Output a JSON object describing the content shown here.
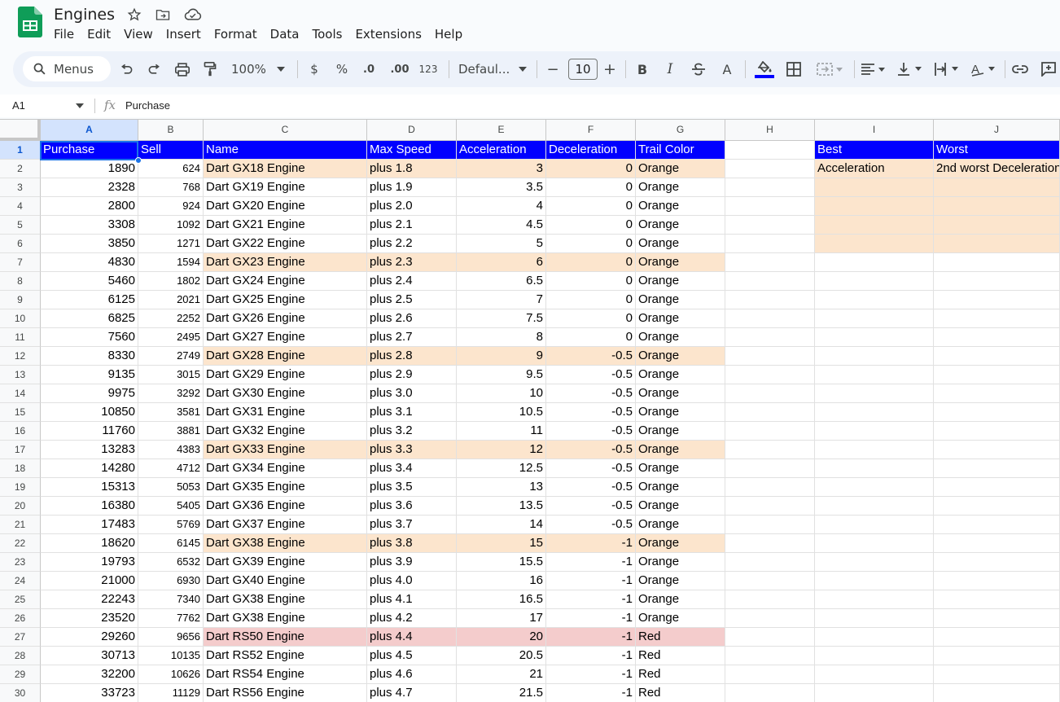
{
  "app": {
    "title": "Engines",
    "brand_color": "#0f9d58"
  },
  "menu": [
    "File",
    "Edit",
    "View",
    "Insert",
    "Format",
    "Data",
    "Tools",
    "Extensions",
    "Help"
  ],
  "toolbar": {
    "search_label": "Menus",
    "zoom": "100%",
    "currency": "$",
    "percent": "%",
    "dec_decrease": ".0",
    "dec_increase": ".00",
    "number_format": "123",
    "font": "Defaul...",
    "font_size": "10",
    "minus": "−",
    "plus": "+"
  },
  "formula_bar": {
    "cell_ref": "A1",
    "fx": "fx",
    "value": "Purchase"
  },
  "columns": [
    "A",
    "B",
    "C",
    "D",
    "E",
    "F",
    "G",
    "H",
    "I",
    "J"
  ],
  "headers": [
    "Purchase",
    "Sell",
    "Name",
    "Max Speed",
    "Acceleration",
    "Deceleration",
    "Trail Color"
  ],
  "side_table": {
    "headers": [
      "Best",
      "Worst"
    ],
    "row1": [
      "Acceleration",
      "2nd worst Deceleration"
    ]
  },
  "rows": [
    {
      "n": "2",
      "purchase": "1890",
      "sell": "624",
      "name": "Dart GX18 Engine",
      "speed": "plus 1.8",
      "acc": "3",
      "dec": "0",
      "trail": "Orange",
      "hl": "orange"
    },
    {
      "n": "3",
      "purchase": "2328",
      "sell": "768",
      "name": "Dart GX19 Engine",
      "speed": "plus 1.9",
      "acc": "3.5",
      "dec": "0",
      "trail": "Orange",
      "hl": ""
    },
    {
      "n": "4",
      "purchase": "2800",
      "sell": "924",
      "name": "Dart GX20 Engine",
      "speed": "plus 2.0",
      "acc": "4",
      "dec": "0",
      "trail": "Orange",
      "hl": ""
    },
    {
      "n": "5",
      "purchase": "3308",
      "sell": "1092",
      "name": "Dart GX21 Engine",
      "speed": "plus 2.1",
      "acc": "4.5",
      "dec": "0",
      "trail": "Orange",
      "hl": ""
    },
    {
      "n": "6",
      "purchase": "3850",
      "sell": "1271",
      "name": "Dart GX22 Engine",
      "speed": "plus 2.2",
      "acc": "5",
      "dec": "0",
      "trail": "Orange",
      "hl": ""
    },
    {
      "n": "7",
      "purchase": "4830",
      "sell": "1594",
      "name": "Dart GX23 Engine",
      "speed": "plus 2.3",
      "acc": "6",
      "dec": "0",
      "trail": "Orange",
      "hl": "orange"
    },
    {
      "n": "8",
      "purchase": "5460",
      "sell": "1802",
      "name": "Dart GX24 Engine",
      "speed": "plus 2.4",
      "acc": "6.5",
      "dec": "0",
      "trail": "Orange",
      "hl": ""
    },
    {
      "n": "9",
      "purchase": "6125",
      "sell": "2021",
      "name": "Dart GX25 Engine",
      "speed": "plus 2.5",
      "acc": "7",
      "dec": "0",
      "trail": "Orange",
      "hl": ""
    },
    {
      "n": "10",
      "purchase": "6825",
      "sell": "2252",
      "name": "Dart GX26 Engine",
      "speed": "plus 2.6",
      "acc": "7.5",
      "dec": "0",
      "trail": "Orange",
      "hl": ""
    },
    {
      "n": "11",
      "purchase": "7560",
      "sell": "2495",
      "name": "Dart GX27 Engine",
      "speed": "plus 2.7",
      "acc": "8",
      "dec": "0",
      "trail": "Orange",
      "hl": ""
    },
    {
      "n": "12",
      "purchase": "8330",
      "sell": "2749",
      "name": "Dart GX28 Engine",
      "speed": "plus 2.8",
      "acc": "9",
      "dec": "-0.5",
      "trail": "Orange",
      "hl": "orange"
    },
    {
      "n": "13",
      "purchase": "9135",
      "sell": "3015",
      "name": "Dart GX29 Engine",
      "speed": "plus 2.9",
      "acc": "9.5",
      "dec": "-0.5",
      "trail": "Orange",
      "hl": ""
    },
    {
      "n": "14",
      "purchase": "9975",
      "sell": "3292",
      "name": "Dart GX30 Engine",
      "speed": "plus 3.0",
      "acc": "10",
      "dec": "-0.5",
      "trail": "Orange",
      "hl": ""
    },
    {
      "n": "15",
      "purchase": "10850",
      "sell": "3581",
      "name": "Dart GX31 Engine",
      "speed": "plus 3.1",
      "acc": "10.5",
      "dec": "-0.5",
      "trail": "Orange",
      "hl": ""
    },
    {
      "n": "16",
      "purchase": "11760",
      "sell": "3881",
      "name": "Dart GX32 Engine",
      "speed": "plus 3.2",
      "acc": "11",
      "dec": "-0.5",
      "trail": "Orange",
      "hl": ""
    },
    {
      "n": "17",
      "purchase": "13283",
      "sell": "4383",
      "name": "Dart GX33 Engine",
      "speed": "plus 3.3",
      "acc": "12",
      "dec": "-0.5",
      "trail": "Orange",
      "hl": "orange"
    },
    {
      "n": "18",
      "purchase": "14280",
      "sell": "4712",
      "name": "Dart GX34 Engine",
      "speed": "plus 3.4",
      "acc": "12.5",
      "dec": "-0.5",
      "trail": "Orange",
      "hl": ""
    },
    {
      "n": "19",
      "purchase": "15313",
      "sell": "5053",
      "name": "Dart GX35 Engine",
      "speed": "plus 3.5",
      "acc": "13",
      "dec": "-0.5",
      "trail": "Orange",
      "hl": ""
    },
    {
      "n": "20",
      "purchase": "16380",
      "sell": "5405",
      "name": "Dart GX36 Engine",
      "speed": "plus 3.6",
      "acc": "13.5",
      "dec": "-0.5",
      "trail": "Orange",
      "hl": ""
    },
    {
      "n": "21",
      "purchase": "17483",
      "sell": "5769",
      "name": "Dart GX37 Engine",
      "speed": "plus 3.7",
      "acc": "14",
      "dec": "-0.5",
      "trail": "Orange",
      "hl": ""
    },
    {
      "n": "22",
      "purchase": "18620",
      "sell": "6145",
      "name": "Dart GX38 Engine",
      "speed": "plus 3.8",
      "acc": "15",
      "dec": "-1",
      "trail": "Orange",
      "hl": "orange"
    },
    {
      "n": "23",
      "purchase": "19793",
      "sell": "6532",
      "name": "Dart GX39 Engine",
      "speed": "plus 3.9",
      "acc": "15.5",
      "dec": "-1",
      "trail": "Orange",
      "hl": ""
    },
    {
      "n": "24",
      "purchase": "21000",
      "sell": "6930",
      "name": "Dart GX40 Engine",
      "speed": "plus 4.0",
      "acc": "16",
      "dec": "-1",
      "trail": "Orange",
      "hl": ""
    },
    {
      "n": "25",
      "purchase": "22243",
      "sell": "7340",
      "name": "Dart GX38 Engine",
      "speed": "plus 4.1",
      "acc": "16.5",
      "dec": "-1",
      "trail": "Orange",
      "hl": ""
    },
    {
      "n": "26",
      "purchase": "23520",
      "sell": "7762",
      "name": "Dart GX38 Engine",
      "speed": "plus 4.2",
      "acc": "17",
      "dec": "-1",
      "trail": "Orange",
      "hl": ""
    },
    {
      "n": "27",
      "purchase": "29260",
      "sell": "9656",
      "name": "Dart RS50 Engine",
      "speed": "plus 4.4",
      "acc": "20",
      "dec": "-1",
      "trail": "Red",
      "hl": "red"
    },
    {
      "n": "28",
      "purchase": "30713",
      "sell": "10135",
      "name": "Dart RS52 Engine",
      "speed": "plus 4.5",
      "acc": "20.5",
      "dec": "-1",
      "trail": "Red",
      "hl": ""
    },
    {
      "n": "29",
      "purchase": "32200",
      "sell": "10626",
      "name": "Dart RS54 Engine",
      "speed": "plus 4.6",
      "acc": "21",
      "dec": "-1",
      "trail": "Red",
      "hl": ""
    },
    {
      "n": "30",
      "purchase": "33723",
      "sell": "11129",
      "name": "Dart RS56 Engine",
      "speed": "plus 4.7",
      "acc": "21.5",
      "dec": "-1",
      "trail": "Red",
      "hl": ""
    }
  ],
  "colors": {
    "header_fill": "#0000ff",
    "highlight_orange": "#fce5cd",
    "highlight_red": "#f4cccc",
    "selection": "#1a73e8"
  }
}
